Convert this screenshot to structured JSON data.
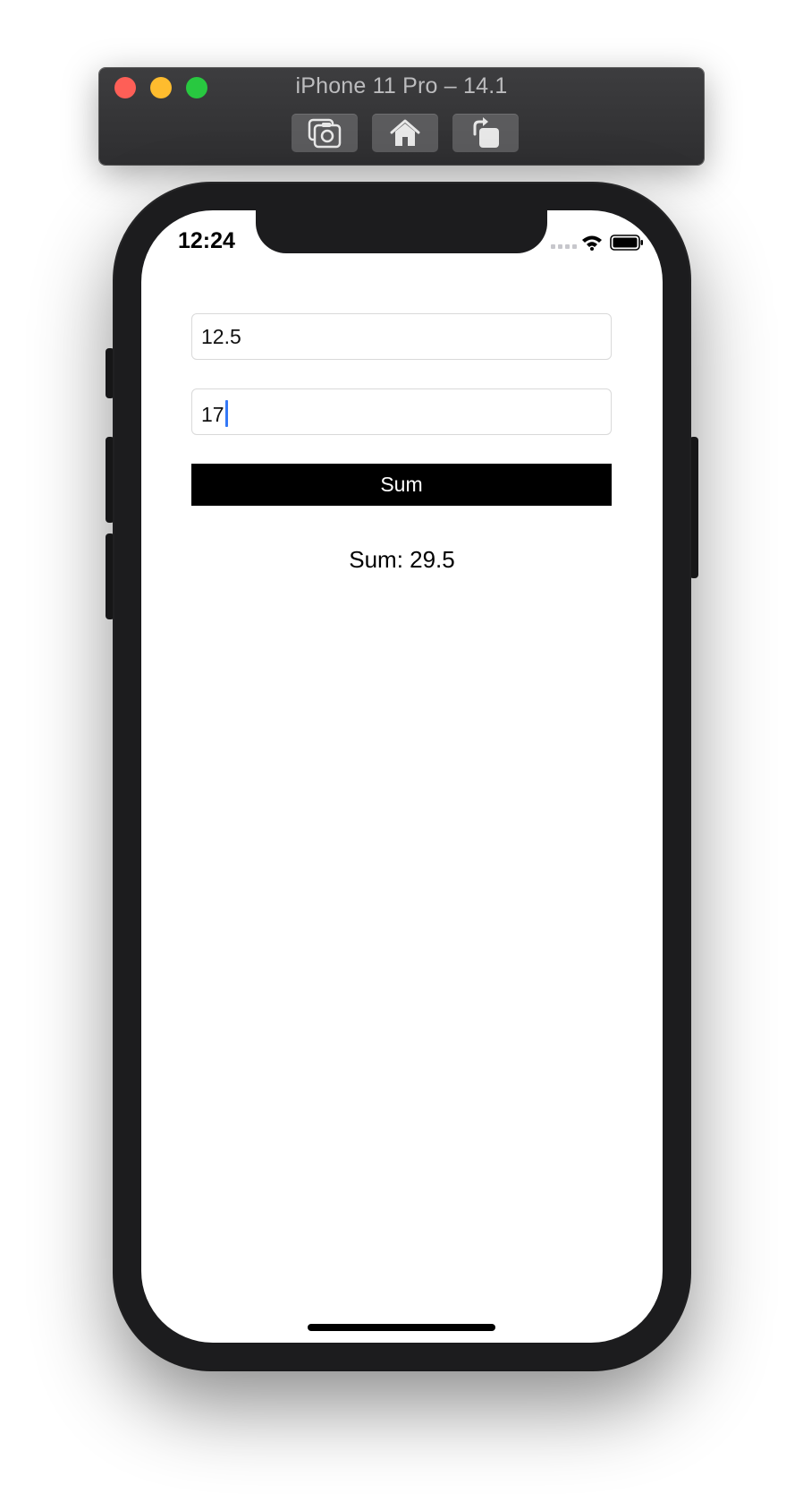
{
  "window": {
    "title": "iPhone 11 Pro – 14.1",
    "toolbar": {
      "screenshot_icon": "camera-icon",
      "home_icon": "home-icon",
      "rotate_icon": "rotate-icon"
    },
    "colors": {
      "close": "#fe5f57",
      "minimize": "#febc2e",
      "zoom": "#28c840"
    }
  },
  "status_bar": {
    "time": "12:24",
    "signal_icon": "cellular-signal-icon",
    "wifi_icon": "wifi-icon",
    "battery_icon": "battery-icon"
  },
  "form": {
    "first_value": "12.5",
    "second_value": "17",
    "button_label": "Sum",
    "result_text": "Sum: 29.5",
    "caret_color": "#3478f6"
  }
}
